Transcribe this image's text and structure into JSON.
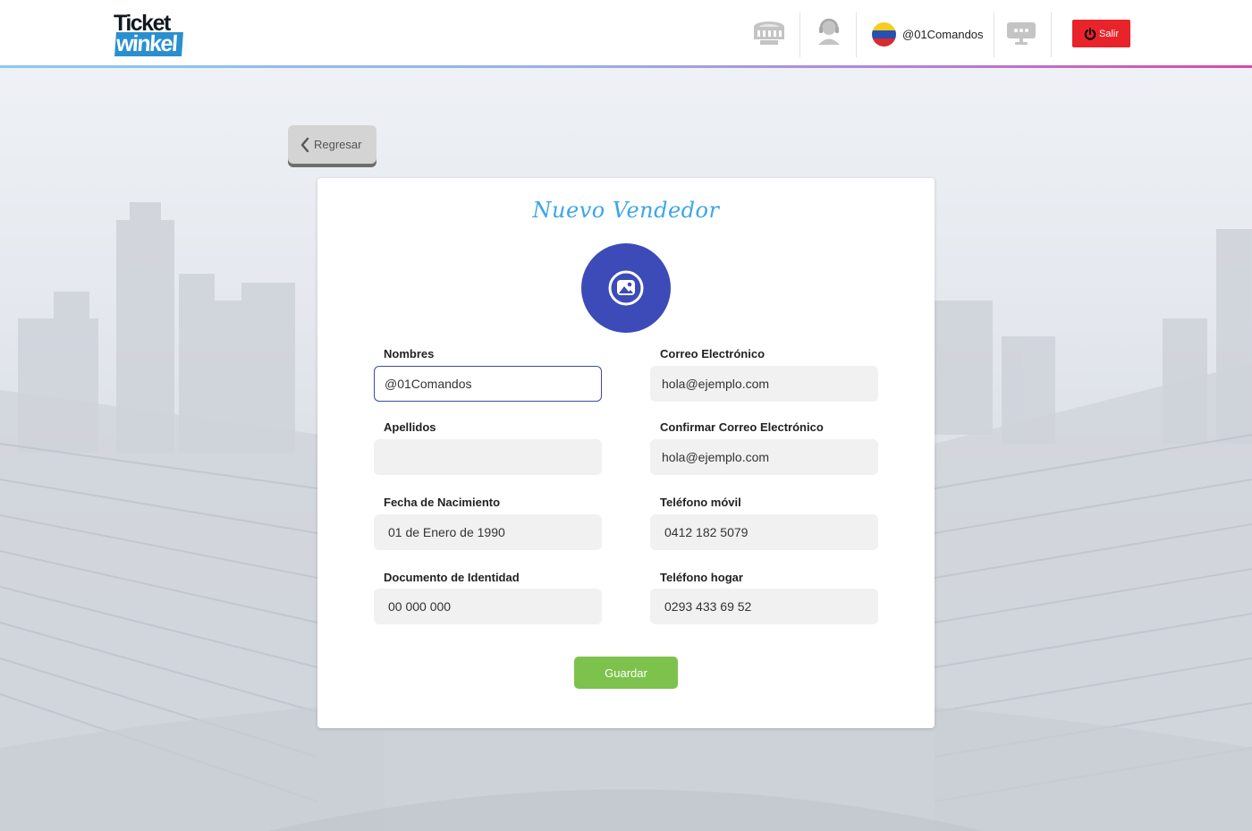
{
  "header": {
    "logo_top": "Ticket",
    "logo_bottom": "winkel",
    "username": "@01Comandos",
    "logout_label": "Salir"
  },
  "back_label": "Regresar",
  "form": {
    "title": "Nuevo Vendedor",
    "fields": [
      {
        "label": "Nombres",
        "value": "@01Comandos"
      },
      {
        "label": "Correo Electrónico",
        "value": "hola@ejemplo.com"
      },
      {
        "label": "Apellidos",
        "value": ""
      },
      {
        "label": "Confirmar Correo Electrónico",
        "value": "hola@ejemplo.com"
      },
      {
        "label": "Fecha de Nacimiento",
        "value": "01 de Enero de 1990"
      },
      {
        "label": "Teléfono móvil",
        "value": "0412 182 5079"
      },
      {
        "label": "Documento de Identidad",
        "value": "00 000 000"
      },
      {
        "label": "Teléfono hogar",
        "value": "0293 433 69 52"
      }
    ],
    "save_label": "Guardar"
  },
  "colors": {
    "title": "#3aa6ea",
    "avatar": "#3c4bb8",
    "save": "#7dc24c",
    "logout": "#e8232a",
    "active_border": "#3b4ba6"
  },
  "icons": [
    "stadium-icon",
    "support-agent-icon",
    "venezuela-flag-icon",
    "chat-monitor-icon",
    "power-icon",
    "chevron-left-icon",
    "image-icon"
  ]
}
